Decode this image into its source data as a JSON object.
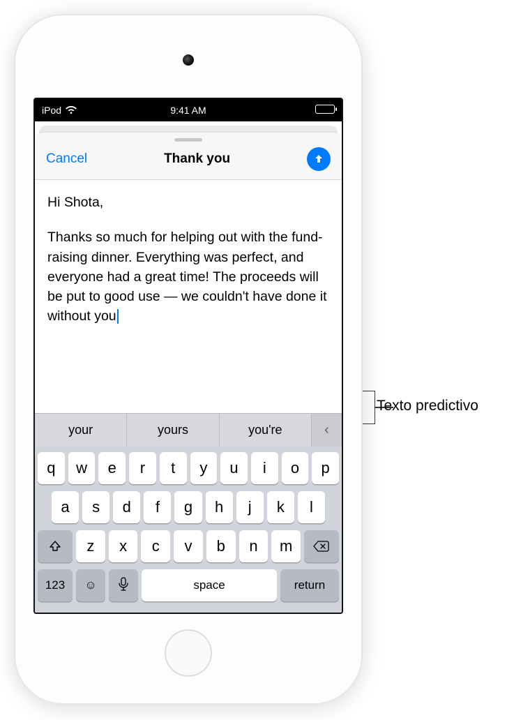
{
  "status": {
    "carrier": "iPod",
    "time": "9:41 AM"
  },
  "nav": {
    "cancel": "Cancel",
    "title": "Thank you"
  },
  "email": {
    "greeting": "Hi Shota,",
    "body": "Thanks so much for helping out with the fund-raising dinner. Everything was perfect, and everyone had a great time! The proceeds will be put to good use — we couldn't have done it without you"
  },
  "predictions": [
    "your",
    "yours",
    "you're"
  ],
  "keyboard": {
    "row1": [
      "q",
      "w",
      "e",
      "r",
      "t",
      "y",
      "u",
      "i",
      "o",
      "p"
    ],
    "row2": [
      "a",
      "s",
      "d",
      "f",
      "g",
      "h",
      "j",
      "k",
      "l"
    ],
    "row3": [
      "z",
      "x",
      "c",
      "v",
      "b",
      "n",
      "m"
    ],
    "numKey": "123",
    "space": "space",
    "return": "return"
  },
  "callout": "Texto predictivo"
}
